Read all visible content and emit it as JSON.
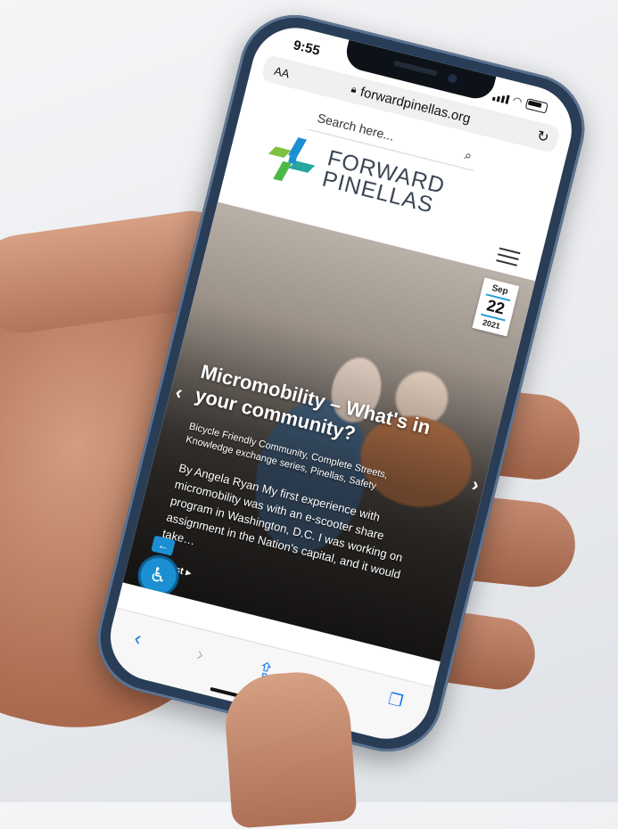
{
  "status_bar": {
    "time": "9:55"
  },
  "browser": {
    "text_size_label": "AA",
    "url": "forwardpinellas.org"
  },
  "site": {
    "search": {
      "placeholder": "Search here..."
    },
    "logo": {
      "line1": "FORWARD",
      "line2": "PINELLAS"
    }
  },
  "post": {
    "date": {
      "month": "Sep",
      "day": "22",
      "year": "2021"
    },
    "title": "Micromobility – What's in your community?",
    "categories": "Bicycle Friendly Community, Complete Streets, Knowledge exchange series, Pinellas, Safety",
    "excerpt": "By Angela Ryan My first experience with micromobility was with an e-scooter share program in Washington, D.C. I was working on assignment in the Nation's capital, and it would take…",
    "read_more": "d post ▸"
  },
  "colors": {
    "accent_blue": "#2a9fd6",
    "logo_green": "#7dc242",
    "logo_blue": "#1b8fd1",
    "ios_blue": "#1577e8"
  },
  "icons": {
    "lock": "lock-icon",
    "reload": "reload-icon",
    "search": "search-icon",
    "menu": "hamburger-menu-icon",
    "accessibility": "wheelchair-icon",
    "share": "share-icon",
    "tabs": "tabs-icon"
  }
}
